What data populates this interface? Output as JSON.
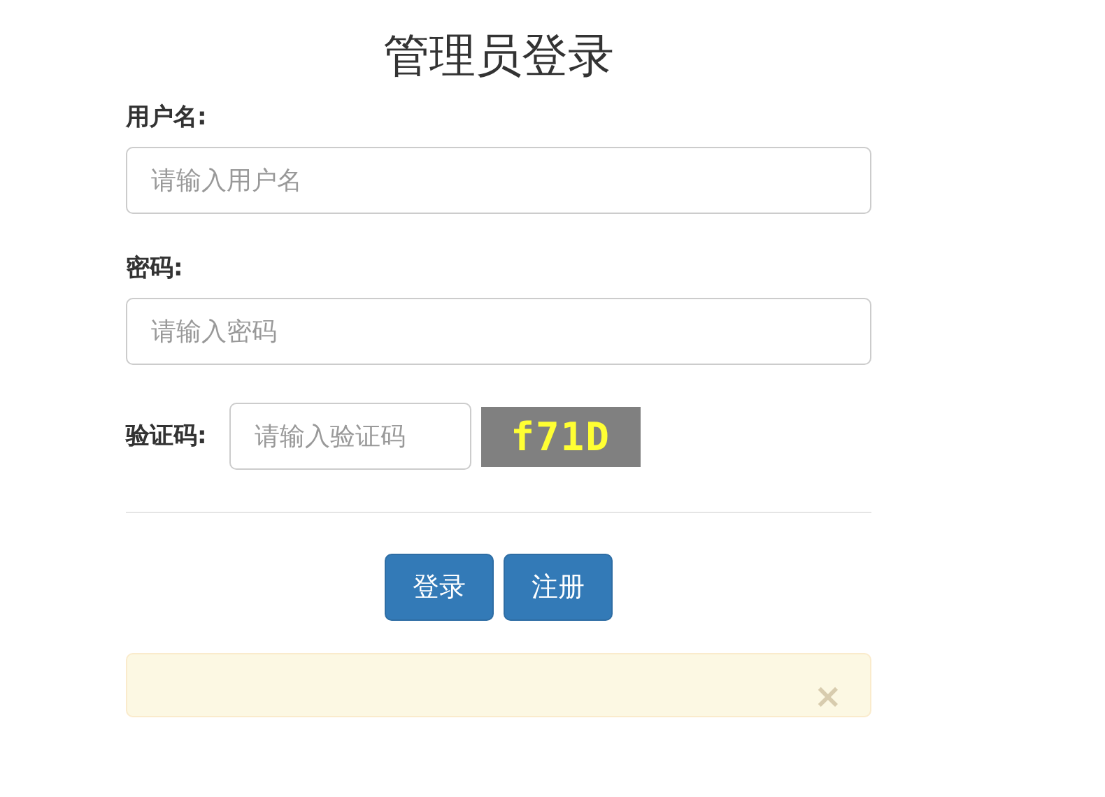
{
  "title": "管理员登录",
  "fields": [
    {
      "label": "用户名:",
      "placeholder": "请输入用户名"
    },
    {
      "label": "密码:",
      "placeholder": "请输入密码"
    }
  ],
  "captcha": {
    "label": "验证码:",
    "placeholder": "请输入验证码",
    "code": "f71D"
  },
  "buttons": [
    {
      "label": "登录"
    },
    {
      "label": "注册"
    }
  ],
  "alert": {
    "close": "×"
  }
}
